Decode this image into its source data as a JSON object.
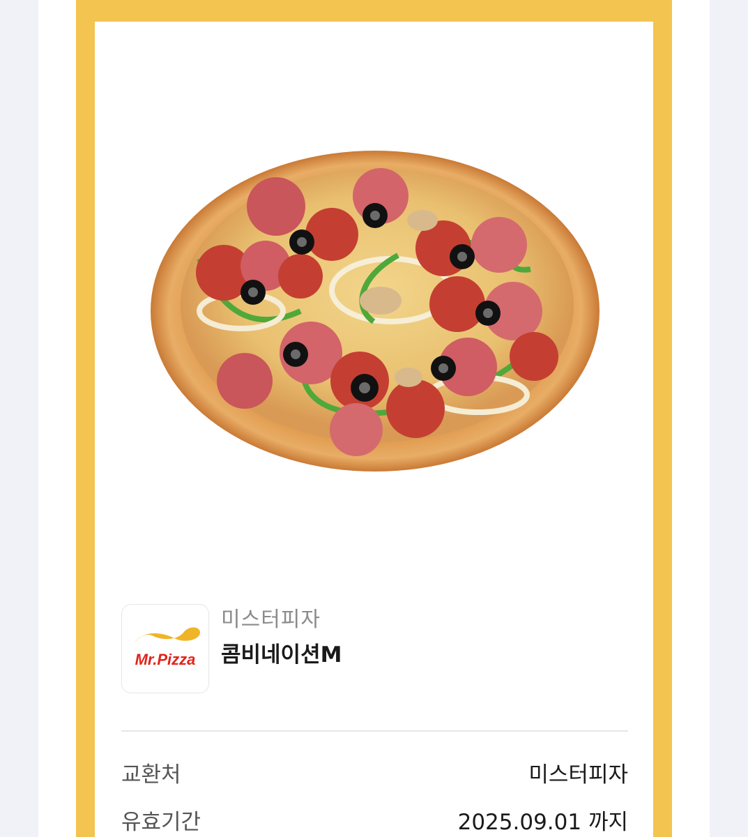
{
  "product": {
    "brand": "미스터피자",
    "name": "콤비네이션M",
    "logo_text": "Mr.Pizza",
    "image_icon": "pizza-photo"
  },
  "details": [
    {
      "label": "교환처",
      "value": "미스터피자"
    },
    {
      "label": "유효기간",
      "value": "2025.09.01 까지"
    }
  ],
  "colors": {
    "frame": "#f3c44f",
    "logo_swoosh": "#f0b429",
    "logo_text": "#e2231a",
    "background": "#eef0f5"
  }
}
